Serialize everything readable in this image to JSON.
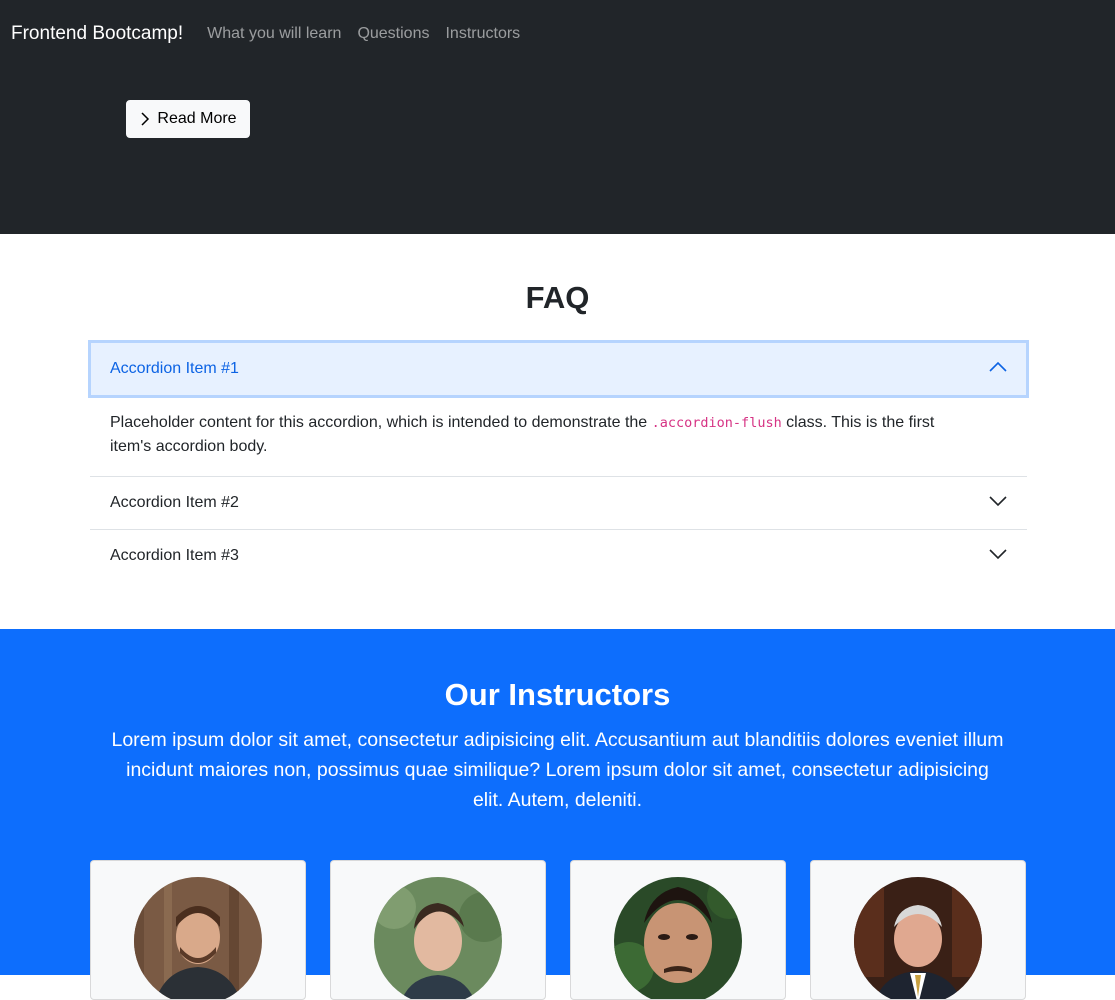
{
  "navbar": {
    "brand": "Frontend Bootcamp!",
    "links": [
      {
        "label": "What you will learn"
      },
      {
        "label": "Questions"
      },
      {
        "label": "Instructors"
      }
    ]
  },
  "hero": {
    "read_more_label": "Read More",
    "read_more_icon": "chevron-right-icon"
  },
  "faq": {
    "title": "FAQ",
    "items": [
      {
        "label": "Accordion Item #1",
        "expanded": true,
        "body_before": "Placeholder content for this accordion, which is intended to demonstrate the ",
        "body_code": ".accordion-flush",
        "body_after": " class. This is the first item's accordion body."
      },
      {
        "label": "Accordion Item #2",
        "expanded": false
      },
      {
        "label": "Accordion Item #3",
        "expanded": false
      }
    ]
  },
  "instructors": {
    "title": "Our Instructors",
    "lead": "Lorem ipsum dolor sit amet, consectetur adipisicing elit. Accusantium aut blanditiis dolores eveniet illum incidunt maiores non, possimus quae similique? Lorem ipsum dolor sit amet, consectetur adipisicing elit. Autem, deleniti.",
    "cards": [
      {
        "avatar": "instructor-photo-1"
      },
      {
        "avatar": "instructor-photo-2"
      },
      {
        "avatar": "instructor-photo-3"
      },
      {
        "avatar": "instructor-photo-4"
      }
    ]
  },
  "colors": {
    "dark_bg": "#212529",
    "primary": "#0d6efd",
    "accordion_active_bg": "#e7f1ff",
    "accordion_active_text": "#0c63e4",
    "code": "#d63384"
  }
}
